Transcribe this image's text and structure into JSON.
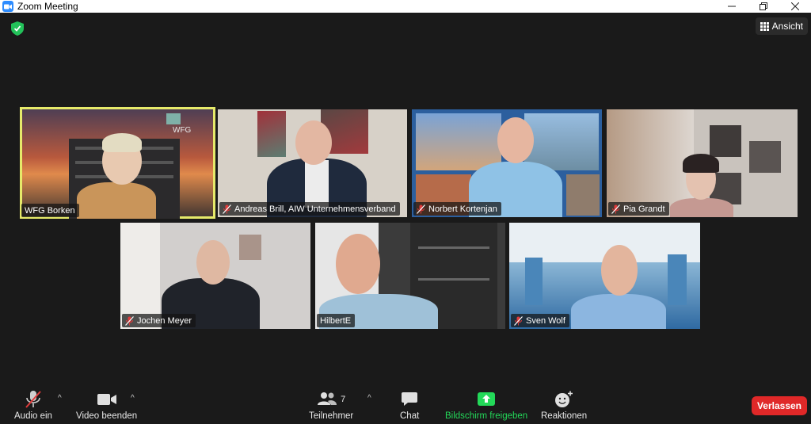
{
  "window": {
    "title": "Zoom Meeting"
  },
  "topbar": {
    "view_label": "Ansicht"
  },
  "participants": [
    {
      "name": "WFG Borken",
      "muted": false,
      "active": true,
      "logo_text": "WFG"
    },
    {
      "name": "Andreas Brill, AIW Unternehmensverband",
      "muted": true,
      "active": false
    },
    {
      "name": "Norbert Kortenjan",
      "muted": true,
      "active": false
    },
    {
      "name": "Pia Grandt",
      "muted": true,
      "active": false
    },
    {
      "name": "Jochen Meyer",
      "muted": true,
      "active": false
    },
    {
      "name": "HilbertE",
      "muted": false,
      "active": false
    },
    {
      "name": "Sven Wolf",
      "muted": true,
      "active": false
    }
  ],
  "toolbar": {
    "audio_label": "Audio ein",
    "video_label": "Video beenden",
    "participants_label": "Teilnehmer",
    "participants_count": "7",
    "chat_label": "Chat",
    "share_label": "Bildschirm freigeben",
    "reactions_label": "Reaktionen",
    "leave_label": "Verlassen"
  },
  "colors": {
    "active_speaker": "#e6ea6a",
    "share_green": "#23d959",
    "leave_red": "#e02828",
    "muted_red": "#e03b3b"
  },
  "icons": [
    "zoom-app-icon",
    "security-shield-icon",
    "grid-view-icon",
    "mic-muted-icon",
    "video-camera-icon",
    "participants-icon",
    "chat-icon",
    "share-screen-icon",
    "reactions-icon"
  ]
}
